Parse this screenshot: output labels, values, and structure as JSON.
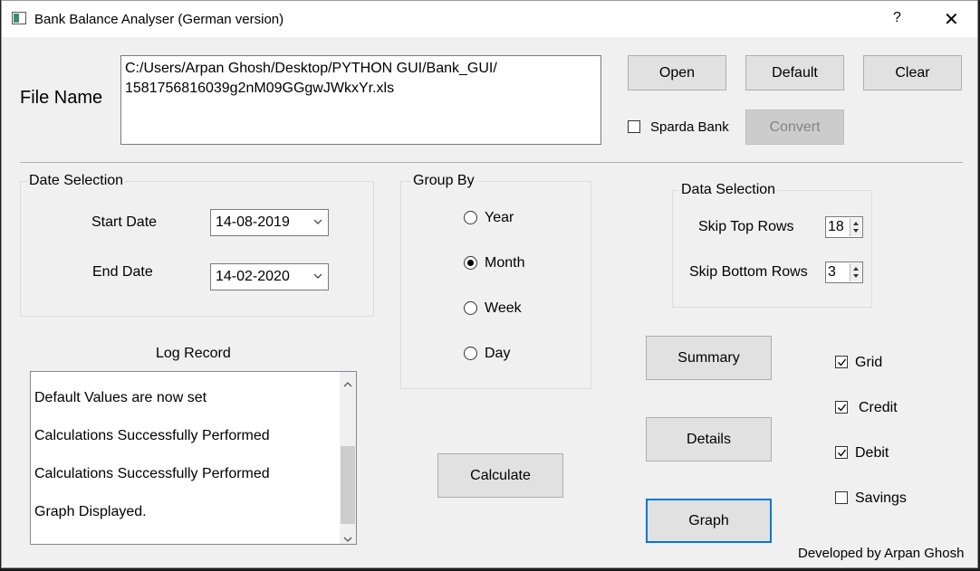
{
  "window": {
    "title": "Bank Balance Analyser (German version)",
    "help_label": "?",
    "close_label": "✕"
  },
  "file": {
    "label": "File Name",
    "path_line1": "C:/Users/Arpan Ghosh/Desktop/PYTHON GUI/Bank_GUI/",
    "path_line2": "1581756816039g2nM09GGgwJWkxYr.xls"
  },
  "buttons": {
    "open": "Open",
    "default": "Default",
    "clear": "Clear",
    "convert": "Convert",
    "summary": "Summary",
    "details": "Details",
    "calculate": "Calculate",
    "graph": "Graph"
  },
  "sparda": {
    "label": "Sparda Bank",
    "checked": false
  },
  "date_selection": {
    "title": "Date Selection",
    "start_label": "Start Date",
    "start_value": "14-08-2019",
    "end_label": "End Date",
    "end_value": "14-02-2020"
  },
  "group_by": {
    "title": "Group By",
    "options": [
      "Year",
      "Month",
      "Week",
      "Day"
    ],
    "selected": "Month"
  },
  "data_selection": {
    "title": "Data Selection",
    "skip_top_label": "Skip Top Rows",
    "skip_top_value": "18",
    "skip_bottom_label": "Skip Bottom Rows",
    "skip_bottom_value": "3"
  },
  "log": {
    "title": "Log Record",
    "lines": [
      "Default Values are now set",
      "Calculations Successfully Performed",
      "Calculations Successfully Performed",
      "Graph Displayed."
    ]
  },
  "options": [
    {
      "label": "Grid",
      "checked": true
    },
    {
      "label": "Credit",
      "checked": true
    },
    {
      "label": "Debit",
      "checked": true
    },
    {
      "label": "Savings",
      "checked": false
    }
  ],
  "footer": "Developed by Arpan Ghosh",
  "colors": {
    "focus_border": "#0078d7",
    "window_bg": "#f0f0f0",
    "button_bg": "#e1e1e1"
  }
}
